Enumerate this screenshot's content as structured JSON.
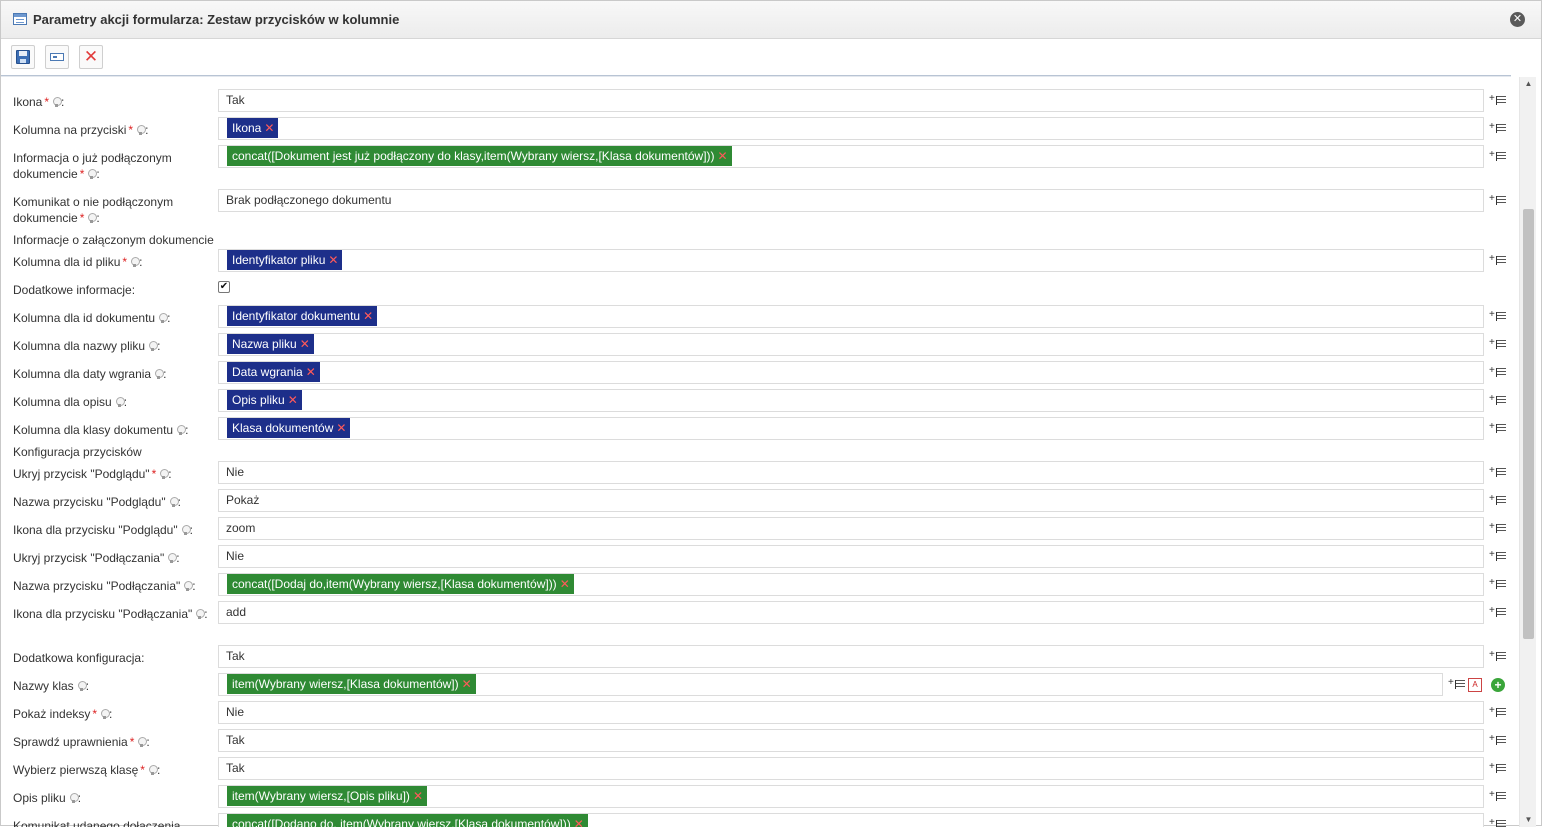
{
  "window": {
    "title": "Parametry akcji formularza: Zestaw przycisków w kolumnie",
    "close_icon": "close-circle-icon"
  },
  "toolbar": {
    "save_icon": "floppy-disk-icon",
    "field_icon": "form-field-icon",
    "cancel_icon": "red-x-icon",
    "cancel_glyph": "✕"
  },
  "checkbox_glyph": "✔",
  "remove_glyph": "✕",
  "add_glyph": "+",
  "pdf_glyph": "A",
  "scroll": {
    "up": "▲",
    "down": "▼"
  },
  "sections": {
    "attached": "Informacje o załączonym dokumencie",
    "buttons": "Konfiguracja przycisków"
  },
  "rows": [
    {
      "label": "Ikona",
      "req": "*",
      "value": "Tak"
    },
    {
      "label": "Kolumna na przyciski",
      "req": "*",
      "tag": "Ikona"
    },
    {
      "label": "Informacja o już podłączonym dokumencie",
      "req": "*",
      "tag": "concat([Dokument jest już podłączony do klasy,item(Wybrany wiersz,[Klasa dokumentów]))"
    },
    {
      "label": "Komunikat o nie podłączonym dokumencie",
      "req": "*",
      "value": "Brak podłączonego dokumentu"
    },
    {
      "label": "Kolumna dla id pliku",
      "req": "*",
      "tag": "Identyfikator pliku"
    },
    {
      "label": "Dodatkowe informacje:",
      "checked": true
    },
    {
      "label": "Kolumna dla id dokumentu",
      "tag": "Identyfikator dokumentu"
    },
    {
      "label": "Kolumna dla nazwy pliku",
      "tag": "Nazwa pliku"
    },
    {
      "label": "Kolumna dla daty wgrania",
      "tag": "Data wgrania"
    },
    {
      "label": "Kolumna dla opisu",
      "tag": "Opis pliku"
    },
    {
      "label": "Kolumna dla klasy dokumentu",
      "tag": "Klasa dokumentów"
    },
    {
      "label": "Ukryj przycisk \"Podglądu\"",
      "req": "*",
      "value": "Nie"
    },
    {
      "label": "Nazwa przycisku \"Podglądu\"",
      "value": "Pokaż"
    },
    {
      "label": "Ikona dla przycisku \"Podglądu\"",
      "value": "zoom"
    },
    {
      "label": "Ukryj przycisk \"Podłączania\"",
      "value": "Nie"
    },
    {
      "label": "Nazwa przycisku \"Podłączania\"",
      "tag": "concat([Dodaj do,item(Wybrany wiersz,[Klasa dokumentów]))"
    },
    {
      "label": "Ikona dla przycisku \"Podłączania\"",
      "value": "add"
    },
    {
      "label": "Dodatkowa konfiguracja:",
      "value": "Tak"
    },
    {
      "label": "Nazwy klas",
      "tag": "item(Wybrany wiersz,[Klasa dokumentów])"
    },
    {
      "label": "Pokaż indeksy",
      "req": "*",
      "value": "Nie"
    },
    {
      "label": "Sprawdź uprawnienia",
      "req": "*",
      "value": "Tak"
    },
    {
      "label": "Wybierz pierwszą klasę",
      "req": "*",
      "value": "Tak"
    },
    {
      "label": "Opis pliku",
      "tag": "item(Wybrany wiersz,[Opis pliku])"
    },
    {
      "label": "Komunikat udanego dołączenia",
      "tag": "concat([Dodano do, item(Wybrany wiersz,[Klasa dokumentów]))"
    }
  ]
}
